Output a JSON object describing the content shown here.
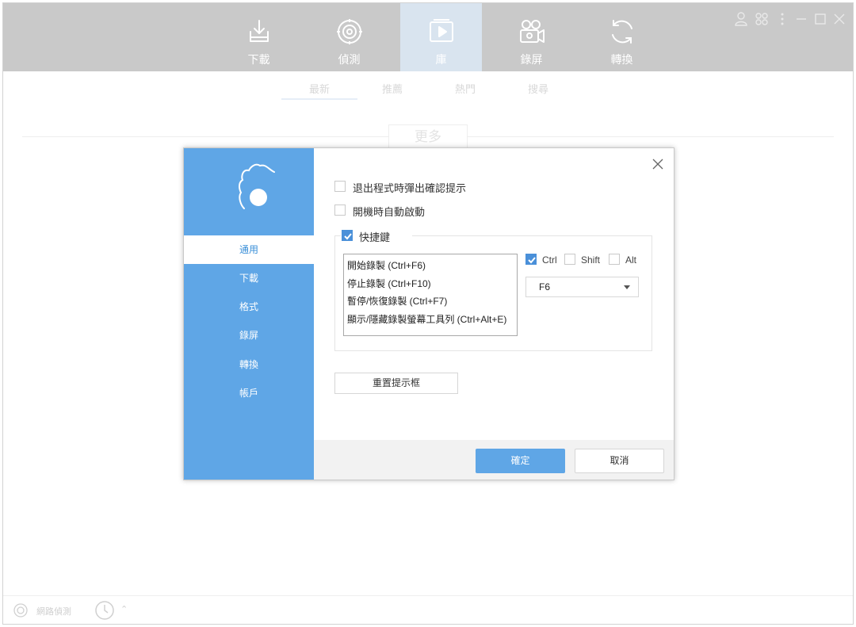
{
  "topnav": {
    "items": [
      {
        "label": "下載",
        "icon": "download-icon"
      },
      {
        "label": "偵測",
        "icon": "sniff-icon"
      },
      {
        "label": "庫",
        "icon": "library-icon",
        "active": true
      },
      {
        "label": "錄屏",
        "icon": "record-icon"
      },
      {
        "label": "轉換",
        "icon": "convert-icon"
      }
    ],
    "window_controls": [
      "user-icon",
      "settings-icon",
      "menu-icon",
      "minimize-icon",
      "maximize-icon",
      "close-icon"
    ]
  },
  "subtabs": [
    "最新",
    "推薦",
    "熱門",
    "搜尋"
  ],
  "more_label": "更多",
  "bottom": {
    "sniff_label": "網路偵測"
  },
  "dialog": {
    "sidebar": [
      "通用",
      "下載",
      "格式",
      "錄屏",
      "轉換",
      "帳戶"
    ],
    "options": {
      "exit_confirm": "退出程式時彈出確認提示",
      "autostart": "開機時自動啟動",
      "hotkey": "快捷鍵"
    },
    "hotkeys": [
      "開始錄製 (Ctrl+F6)",
      "停止錄製 (Ctrl+F10)",
      "暫停/恢復錄製 (Ctrl+F7)",
      "顯示/隱藏錄製螢幕工具列 (Ctrl+Alt+E)"
    ],
    "modifiers": {
      "ctrl": "Ctrl",
      "shift": "Shift",
      "alt": "Alt"
    },
    "key_select": "F6",
    "reset_label": "重置提示框",
    "ok_label": "確定",
    "cancel_label": "取消"
  },
  "colors": {
    "accent": "#5fa6e6",
    "check": "#4a90d9",
    "topbar": "#c9c9c9"
  }
}
